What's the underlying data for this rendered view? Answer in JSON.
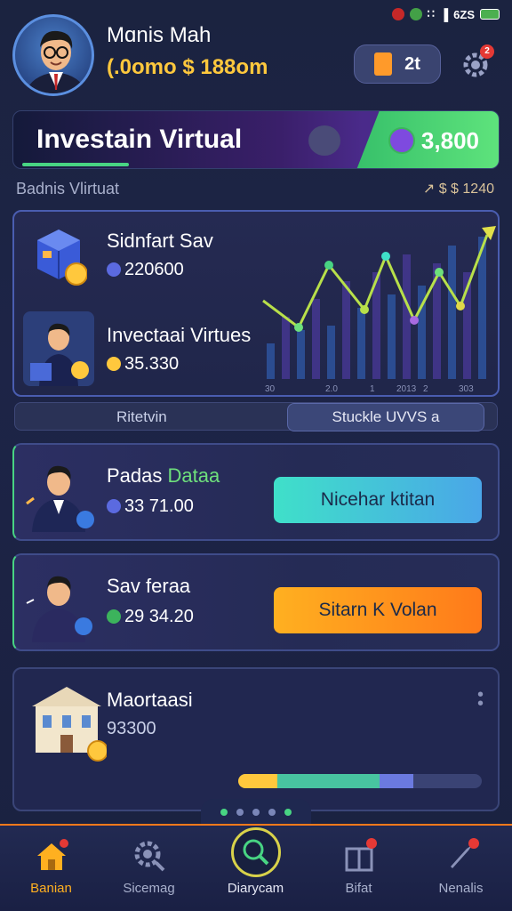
{
  "header": {
    "user_name": "Mɑnis Mah",
    "balance_prefix": "(.0omo",
    "balance_suffix": "$ 188om",
    "wallet_count": "2t",
    "settings_badge": "2"
  },
  "status_bar": {
    "text": "6ZS"
  },
  "banner": {
    "title": "Investain Virtual",
    "amount": "3,800"
  },
  "section": {
    "label": "Badnis Vlirtuat",
    "right_text": "↗ $ $ 1240"
  },
  "portfolio": {
    "item1_title": "Sidnfart Sav",
    "item1_value": "220600",
    "item2_title": "Invectaai Virtues",
    "item2_value": "35.330",
    "chart_axis": [
      "30",
      "2.0",
      "1",
      "2013",
      "2",
      "303"
    ]
  },
  "toggle": {
    "left": "Ritetvin",
    "right": "Stuckle UVVS a"
  },
  "offers": [
    {
      "title_a": "Padas ",
      "title_b": "Dataa",
      "value": "33 71.00",
      "button": "Nicehar ktitan"
    },
    {
      "title_a": "Sav feraa",
      "title_b": "",
      "value": "29 34.20",
      "button": "Sitarn K Volan"
    }
  ],
  "card4": {
    "title": "Maortaasi",
    "value": "93300",
    "progress": {
      "yellow": 0.16,
      "teal": 0.58,
      "blue": 0.72
    }
  },
  "nav": [
    {
      "label": "Banian",
      "badge": ""
    },
    {
      "label": "Sicemag",
      "badge": ""
    },
    {
      "label": "Diarycam",
      "badge": ""
    },
    {
      "label": "Bifat",
      "badge": "3"
    },
    {
      "label": "Nenalis",
      "badge": "3"
    }
  ],
  "colors": {
    "accent_green": "#48d483",
    "accent_orange": "#ff7a1a",
    "gold": "#ffc83d",
    "teal_button": "#3fe0c9"
  }
}
